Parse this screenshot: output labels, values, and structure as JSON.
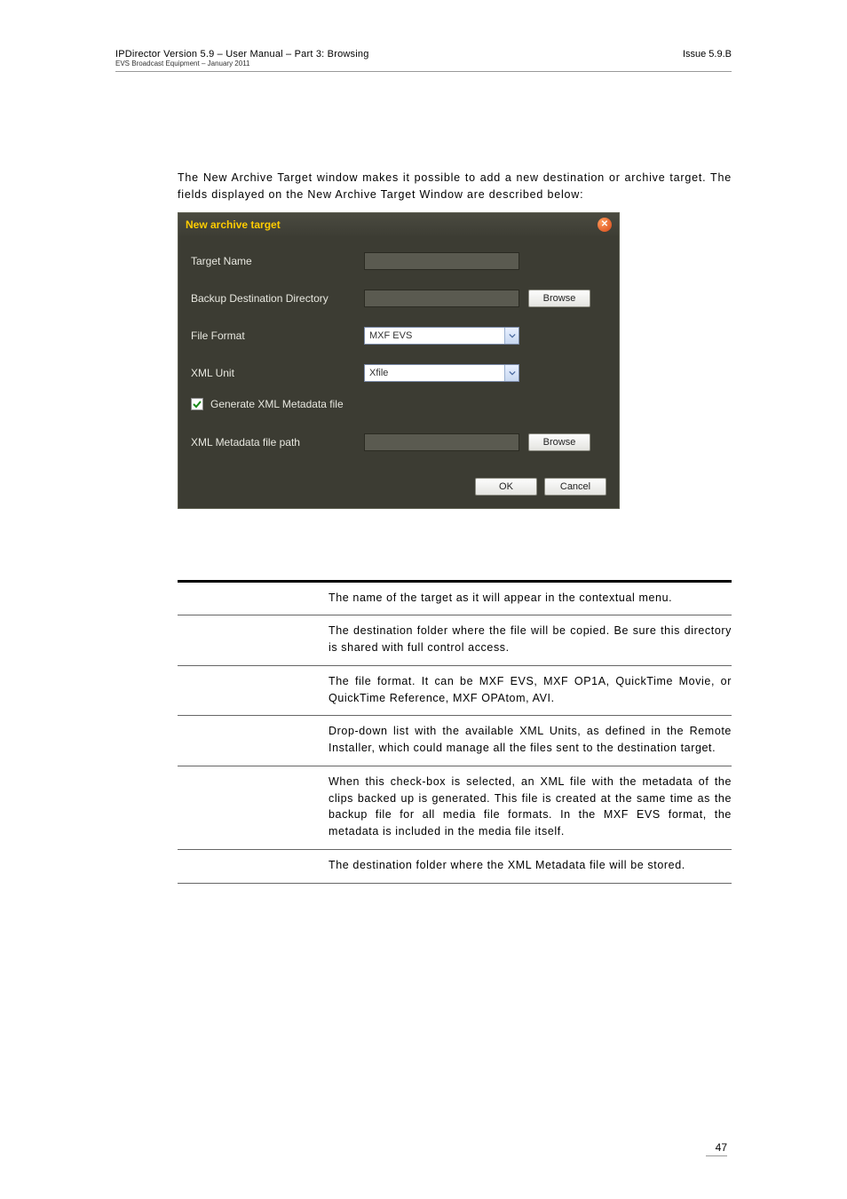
{
  "header": {
    "line1": "IPDirector Version 5.9 – User Manual – Part 3: Browsing",
    "line2": "EVS Broadcast Equipment – January 2011",
    "issue": "Issue 5.9.B"
  },
  "intro": "The New Archive Target window makes it possible to add a new destination or archive target. The fields displayed on the New Archive Target Window are described below:",
  "dialog": {
    "title": "New archive target",
    "rows": {
      "target_name_label": "Target Name",
      "backup_dir_label": "Backup Destination Directory",
      "file_format_label": "File Format",
      "file_format_value": "MXF EVS",
      "xml_unit_label": "XML Unit",
      "xml_unit_value": "Xfile",
      "generate_xml_label": "Generate XML Metadata file",
      "xml_path_label": "XML Metadata file path"
    },
    "buttons": {
      "browse": "Browse",
      "ok": "OK",
      "cancel": "Cancel"
    }
  },
  "descriptions": [
    "The name of the target as it will appear in the contextual menu.",
    "The destination folder where the file will be copied. Be sure this directory is shared with full control access.",
    "The file format. It can be MXF EVS, MXF OP1A, QuickTime Movie, or QuickTime Reference, MXF OPAtom, AVI.",
    "Drop-down list with the available XML Units, as defined in the Remote Installer, which could manage all the files sent to the destination target.",
    "When this check-box is selected, an XML file with the metadata of the clips backed up is generated. This file is created at the same time as the backup file for all media file formats. In the MXF EVS format, the metadata is included in the media file itself.",
    "The destination folder where the XML Metadata file will be stored."
  ],
  "page_number": "47"
}
